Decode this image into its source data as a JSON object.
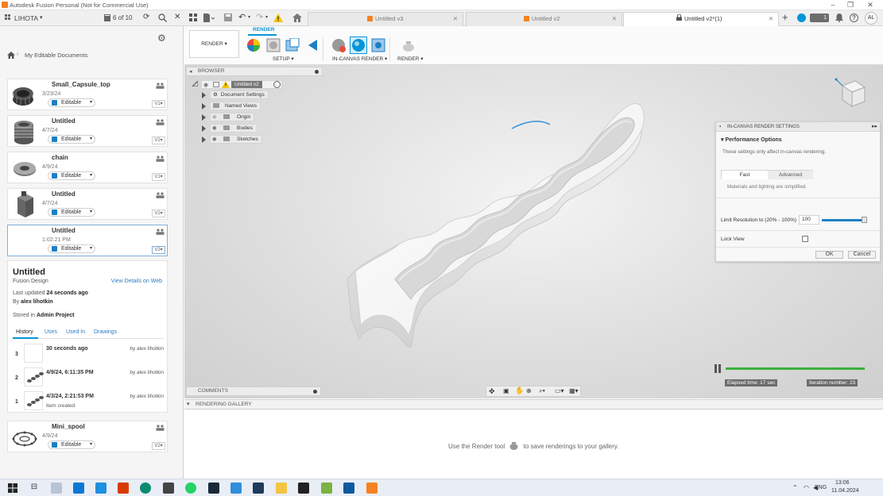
{
  "window": {
    "title": "Autodesk Fusion Personal (Not for Commercial Use)"
  },
  "topbar": {
    "team": "LIHOTA",
    "doc_count": "6 of 10",
    "user_initials": "AL",
    "notification_count": "1"
  },
  "tabs": [
    {
      "label": "Untitled v3"
    },
    {
      "label": "Untitled v2"
    },
    {
      "label": "Untitled v2*(1)"
    }
  ],
  "data_panel": {
    "breadcrumb": "My Editable Documents",
    "files": [
      {
        "name": "Small_Capsule_top",
        "date": "3/23/24",
        "status": "Editable",
        "version": "V1"
      },
      {
        "name": "Untitled",
        "date": "4/7/24",
        "status": "Editable",
        "version": "V2"
      },
      {
        "name": "chain",
        "date": "4/9/24",
        "status": "Editable",
        "version": "V1"
      },
      {
        "name": "Untitled",
        "date": "4/7/24",
        "status": "Editable",
        "version": "V2"
      },
      {
        "name": "Untitled",
        "date": "1:02:21 PM",
        "status": "Editable",
        "version": "V3"
      },
      {
        "name": "Mini_spool",
        "date": "4/9/24",
        "status": "Editable",
        "version": "V2"
      }
    ],
    "details": {
      "title": "Untitled",
      "type": "Fusion Design",
      "view_link": "View Details on Web",
      "updated_prefix": "Last updated",
      "updated_value": "24 seconds ago",
      "by_prefix": "By",
      "by_value": "alex lihotkin",
      "stored_prefix": "Stored in",
      "stored_value": "Admin Project",
      "tabs": [
        "History",
        "Uses",
        "Used In",
        "Drawings"
      ],
      "history": [
        {
          "num": "3",
          "when": "30 seconds ago",
          "by": "by alex lihotkin",
          "note": ""
        },
        {
          "num": "2",
          "when": "4/9/24, 6:11:35 PM",
          "by": "by alex lihotkin",
          "note": ""
        },
        {
          "num": "1",
          "when": "4/3/24, 2:21:53 PM",
          "by": "by alex lihotkin",
          "note": "Item created"
        }
      ]
    }
  },
  "toolbar": {
    "workspace": "RENDER",
    "tab": "RENDER",
    "groups": [
      "SETUP",
      "IN-CANVAS RENDER",
      "RENDER"
    ]
  },
  "browser": {
    "header": "BROWSER",
    "root": "Untitled v2",
    "items": [
      "Document Settings",
      "Named Views",
      "Origin",
      "Bodies",
      "Sketches"
    ]
  },
  "render_settings": {
    "header": "IN-CANVAS RENDER SETTINGS",
    "section": "Performance Options",
    "note": "These settings only affect in-canvas rendering.",
    "tabs": [
      "Fast",
      "Advanced"
    ],
    "tab_note": "Materials and lighting are simplified.",
    "resolution_label": "Limit Resolution to (20% - 100%)",
    "resolution_value": "100",
    "lock_view_label": "Lock View",
    "ok": "OK",
    "cancel": "Cancel"
  },
  "render_status": {
    "elapsed": "Elapsed time: 17 sec",
    "iteration": "Iteration number: 23",
    "progress": 1.0
  },
  "comments": {
    "label": "COMMENTS"
  },
  "gallery": {
    "label": "RENDERING GALLERY",
    "hint_before": "Use the Render tool",
    "hint_after": "to save renderings to your gallery."
  },
  "taskbar": {
    "lang": "ENG",
    "time": "13:06",
    "date": "11.04.2024"
  },
  "colors": {
    "accent": "#0696d7",
    "progress": "#3ab03e",
    "brand": "#f58220"
  }
}
